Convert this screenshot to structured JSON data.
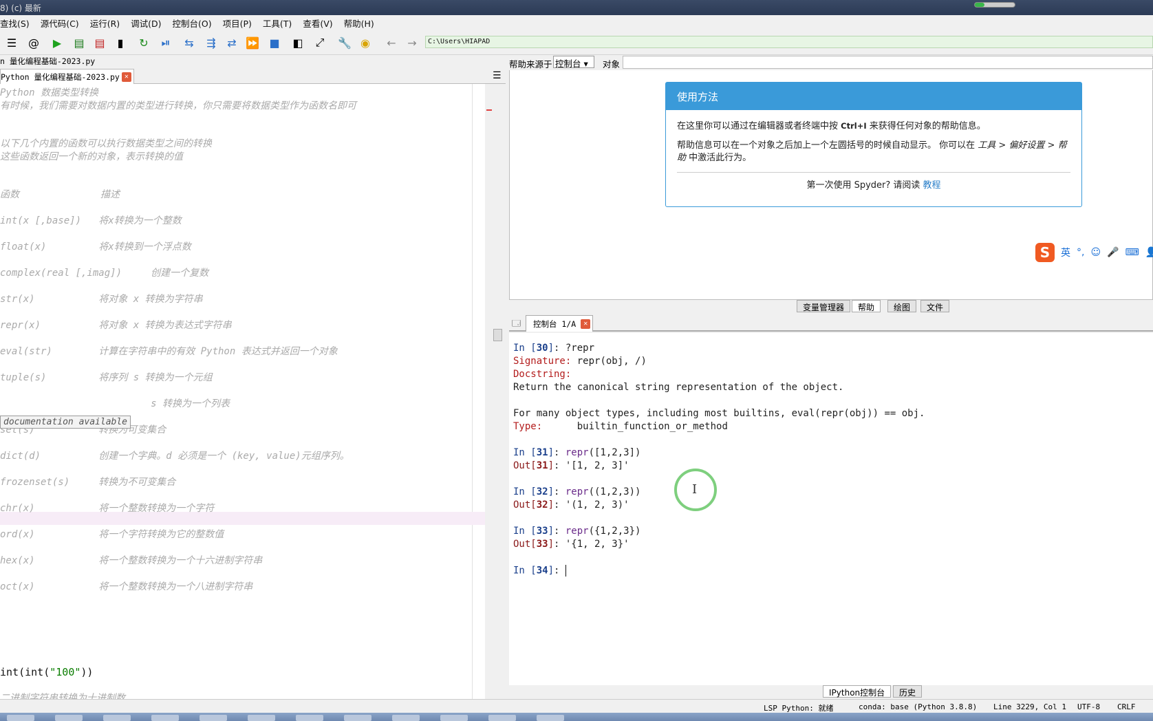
{
  "titlebar": {
    "text": "8) (c) 最新"
  },
  "menu": [
    "查找(S)",
    "源代码(C)",
    "运行(R)",
    "调试(D)",
    "控制台(O)",
    "项目(P)",
    "工具(T)",
    "查看(V)",
    "帮助(H)"
  ],
  "toolbar": {
    "icons": [
      "list-icon",
      "at-icon",
      "run-icon",
      "run-cell-icon",
      "run-cell-advance-icon",
      "run-selection-icon",
      "rerun-icon",
      "debug-icon",
      "step-icon",
      "step-into-icon",
      "step-return-icon",
      "continue-icon",
      "stop-icon",
      "maximize-pane-icon",
      "fullscreen-icon",
      "preferences-icon",
      "python-path-icon",
      "back-icon",
      "forward-icon"
    ],
    "path": "C:\\Users\\HIAPAD"
  },
  "editor": {
    "file_title": "n 量化编程基础-2023.py",
    "tab_label": "Python 量化编程基础-2023.py",
    "tooltip": "documentation available",
    "lines": [
      "Python 数据类型转换",
      "有时候，我们需要对数据内置的类型进行转换，你只需要将数据类型作为函数名即可",
      "以下几个内置的函数可以执行数据类型之间的转换",
      "这些函数返回一个新的对象，表示转换的值",
      "函数              描述",
      "int(x [,base])   将x转换为一个整数",
      "float(x)         将x转换到一个浮点数",
      "complex(real [,imag])     创建一个复数",
      "str(x)           将对象 x 转换为字符串",
      "repr(x)          将对象 x 转换为表达式字符串",
      "eval(str)        计算在字符串中的有效 Python 表达式并返回一个对象",
      "tuple(s)         将序列 s 转换为一个元组",
      "                          s 转换为一个列表",
      "set(s)           转换为可变集合",
      "dict(d)          创建一个字典。d 必须是一个 (key, value)元组序列。",
      "frozenset(s)     转换为不可变集合",
      "chr(x)           将一个整数转换为一个字符",
      "ord(x)           将一个字符转换为它的整数值",
      "hex(x)           将一个整数转换为一个十六进制字符串",
      "oct(x)           将一个整数转换为一个八进制字符串"
    ],
    "code_prefix": "int(int(",
    "code_string": "\"100\"",
    "code_suffix": "))",
    "last_comment": "二进制字符串转换为十进制数"
  },
  "help": {
    "source_label": "帮助来源于",
    "source_value": "控制台",
    "object_label": "对象",
    "card_title": "使用方法",
    "p1_a": "在这里你可以通过在编辑器或者终端中按 ",
    "p1_kbd": "Ctrl+I",
    "p1_b": " 来获得任何对象的帮助信息。",
    "p2_a": "帮助信息可以在一个对象之后加上一个左圆括号的时候自动显示。 你可以在 ",
    "p2_em": "工具 > 偏好设置 > 帮助",
    "p2_b": " 中激活此行为。",
    "p3_a": "第一次使用 Spyder? 请阅读 ",
    "p3_link": "教程"
  },
  "ime": {
    "logo": "S",
    "lang": "英"
  },
  "pane_tabs": [
    "变量管理器",
    "帮助",
    "绘图",
    "文件"
  ],
  "console": {
    "tab_label": "控制台 1/A",
    "l1_prompt": "In [",
    "l1_num": "30",
    "l1_code": "]: ?repr",
    "sig_label": "Signature:",
    "sig_val": " repr(obj, /)",
    "doc_label": "Docstring:",
    "doc1": "Return the canonical string representation of the object.",
    "doc2": "For many object types, including most builtins, eval(repr(obj)) == obj.",
    "type_label": "Type:",
    "type_val": "      builtin_function_or_method",
    "in31": "31",
    "in31_code": "([1,2,3])",
    "out31": "'[1, 2, 3]'",
    "in32": "32",
    "in32_code": "((1,2,3))",
    "out32": "'(1, 2, 3)'",
    "in33": "33",
    "in33_code": "({1,2,3})",
    "out33": "'{1, 2, 3}'",
    "in34": "34",
    "fn": "repr"
  },
  "bottom_tabs": [
    "IPython控制台",
    "历史"
  ],
  "status": {
    "lsp": "LSP Python: 就绪",
    "conda": "conda: base (Python 3.8.8)",
    "pos": "Line 3229, Col 1",
    "enc": "UTF-8",
    "eol": "CRLF"
  }
}
